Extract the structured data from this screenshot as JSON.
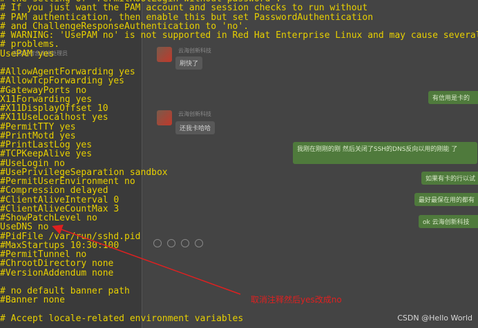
{
  "chat": {
    "list_items": [
      "在校区宿舍连接处理员",
      "",
      "",
      "",
      "",
      "",
      "",
      "",
      "",
      "",
      "",
      ""
    ],
    "messages_in": [
      {
        "meta": "云海创新科技",
        "text": "刷快了"
      },
      {
        "meta": "云海创新科技",
        "text": "还我卡哈哈"
      }
    ],
    "messages_out": [
      "有信用是卡的",
      "我刚在刚刚的刚 然后关闭了SSH的DNS反向以用的刚能 了",
      "如果有卡的行以试",
      "最好最保在用的都有",
      "ok 云海创新科技"
    ]
  },
  "terminal": {
    "lines": [
      "# the setting of \"PermitRootLogin without-password\".",
      "# If you just want the PAM account and session checks to run without",
      "# PAM authentication, then enable this but set PasswordAuthentication",
      "# and ChallengeResponseAuthentication to 'no'.",
      "# WARNING: 'UsePAM no' is not supported in Red Hat Enterprise Linux and may cause several",
      "# problems.",
      "UsePAM yes",
      "",
      "#AllowAgentForwarding yes",
      "#AllowTcpForwarding yes",
      "#GatewayPorts no",
      "X11Forwarding yes",
      "#X11DisplayOffset 10",
      "#X11UseLocalhost yes",
      "#PermitTTY yes",
      "#PrintMotd yes",
      "#PrintLastLog yes",
      "#TCPKeepAlive yes",
      "#UseLogin no",
      "#UsePrivilegeSeparation sandbox",
      "#PermitUserEnvironment no",
      "#Compression delayed",
      "#ClientAliveInterval 0",
      "#ClientAliveCountMax 3",
      "#ShowPatchLevel no",
      "UseDNS no",
      "#PidFile /var/run/sshd.pid",
      "#MaxStartups 10:30:100",
      "#PermitTunnel no",
      "#ChrootDirectory none",
      "#VersionAddendum none",
      "",
      "# no default banner path",
      "#Banner none",
      "",
      "# Accept locale-related environment variables"
    ]
  },
  "annotation": {
    "note": "取消注释然后yes改成no",
    "color": "#e02020"
  },
  "watermark": "CSDN @Hello World"
}
